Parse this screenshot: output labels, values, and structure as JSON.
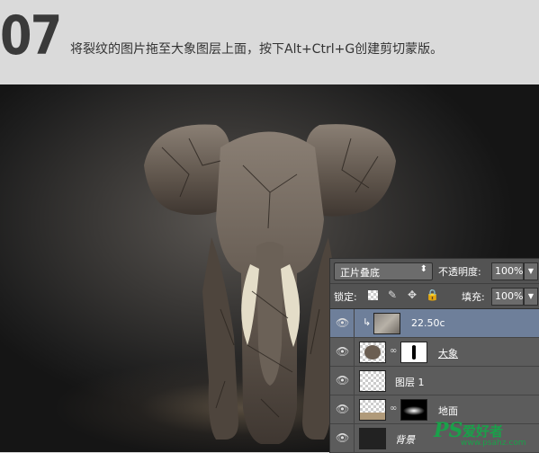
{
  "header": {
    "step_number": "07",
    "instruction": "将裂纹的图片拖至大象图层上面，按下Alt+Ctrl+G创建剪切蒙版。"
  },
  "layers_panel": {
    "blend_mode": "正片叠底",
    "opacity_label": "不透明度:",
    "opacity_value": "100%",
    "lock_label": "锁定:",
    "fill_label": "填充:",
    "fill_value": "100%",
    "layers": [
      {
        "name": "22.50c",
        "selected": true,
        "clipped": true
      },
      {
        "name": "大象",
        "selected": false,
        "has_mask": true
      },
      {
        "name": "图层 1",
        "selected": false
      },
      {
        "name": "地面",
        "selected": false,
        "has_mask": true
      },
      {
        "name": "背景",
        "selected": false
      }
    ]
  },
  "watermark": {
    "logo": "PS",
    "site_name": "爱好者",
    "url": "www.psahz.com"
  },
  "colors": {
    "selected_layer": "#6e7f9a",
    "panel_bg": "#5c5c5c",
    "watermark": "#1aa14a"
  }
}
